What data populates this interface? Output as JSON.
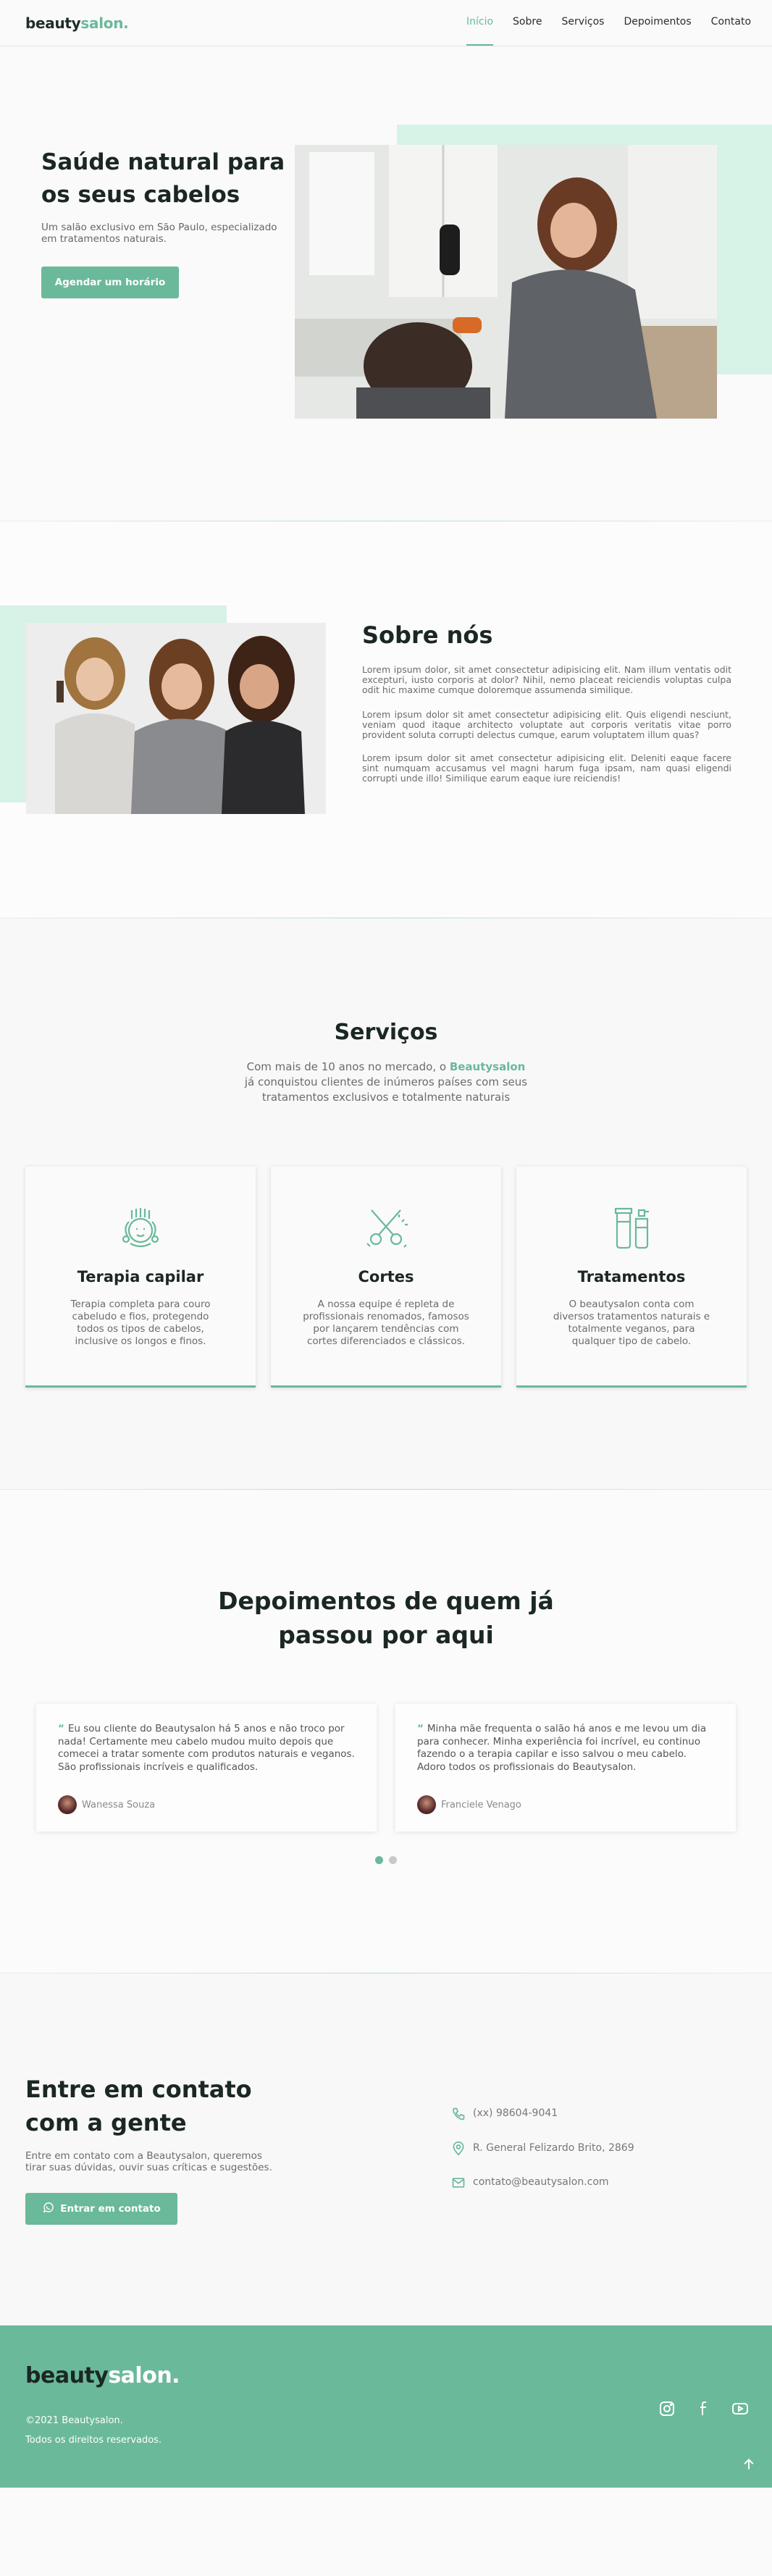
{
  "brand": {
    "name_dark": "beauty",
    "name_accent": "salon."
  },
  "nav": {
    "items": [
      {
        "label": "Início",
        "active": true
      },
      {
        "label": "Sobre",
        "active": false
      },
      {
        "label": "Serviços",
        "active": false
      },
      {
        "label": "Depoimentos",
        "active": false
      },
      {
        "label": "Contato",
        "active": false
      }
    ]
  },
  "home": {
    "title": "Saúde natural para os seus cabelos",
    "description": "Um salão exclusivo em São Paulo, especializado em tratamentos naturais.",
    "cta_label": "Agendar um horário"
  },
  "about": {
    "title": "Sobre nós",
    "paragraphs": [
      "Lorem ipsum dolor, sit amet consectetur adipisicing elit. Nam illum ventatis odit excepturi, iusto corporis at dolor? Nihil, nemo placeat reiciendis voluptas culpa odit hic maxime cumque doloremque assumenda similique.",
      "Lorem ipsum dolor sit amet consectetur adipisicing elit. Quis eligendi nesciunt, veniam quod itaque architecto voluptate aut corporis veritatis vitae porro provident soluta corrupti delectus cumque, earum voluptatem illum quas?",
      "Lorem ipsum dolor sit amet consectetur adipisicing elit. Deleniti eaque facere sint numquam accusamus vel magni harum fuga ipsam, nam quasi eligendi corrupti unde illo! Similique earum eaque iure reiciendis!"
    ]
  },
  "services": {
    "title": "Serviços",
    "subtitle_pre": "Com mais de 10 anos no mercado, o ",
    "subtitle_brand": "Beautysalon",
    "subtitle_post": " já conquistou clientes de inúmeros países com seus tratamentos exclusivos e totalmente naturais",
    "cards": [
      {
        "icon": "hair-therapy-icon",
        "title": "Terapia capilar",
        "description": "Terapia completa para couro cabeludo e fios, protegendo todos os tipos de cabelos, inclusive os longos e finos."
      },
      {
        "icon": "scissors-icon",
        "title": "Cortes",
        "description": "A nossa equipe é repleta de profissionais renomados, famosos por lançarem tendências com cortes diferenciados e clássicos."
      },
      {
        "icon": "products-icon",
        "title": "Tratamentos",
        "description": "O beautysalon conta com diversos tratamentos naturais e totalmente veganos, para qualquer tipo de cabelo."
      }
    ]
  },
  "testimonials": {
    "title_line1": "Depoimentos de quem já",
    "title_line2": "passou por aqui",
    "items": [
      {
        "quote_mark": "“",
        "text": "Eu sou cliente do Beautysalon há 5 anos e não troco por nada! Certamente meu cabelo mudou muito depois que comecei a tratar somente com produtos naturais e veganos. São profissionais incríveis e qualificados.",
        "author": "Wanessa Souza"
      },
      {
        "quote_mark": "“",
        "text": "Minha mãe frequenta o salão há anos e me levou um dia para conhecer. Minha experiência foi incrível, eu continuo fazendo o a terapia capilar e isso salvou o meu cabelo. Adoro todos os profissionais do Beautysalon.",
        "author": "Franciele Venago"
      }
    ],
    "pagination": {
      "pages": 2,
      "current": 1
    }
  },
  "contact": {
    "title": "Entre em contato com a gente",
    "description": "Entre em contato com a Beautysalon, queremos tirar suas dúvidas, ouvir suas críticas e sugestões.",
    "cta_label": "Entrar em contato",
    "phone": "(xx) 98604-9041",
    "address": "R. General Felizardo Brito, 2869",
    "email": "contato@beautysalon.com"
  },
  "footer": {
    "copyright": "©2021 Beautysalon.",
    "rights": "Todos os direitos reservados.",
    "social": [
      "instagram-icon",
      "facebook-icon",
      "youtube-icon"
    ]
  },
  "colors": {
    "accent": "#6ab99a",
    "accent_light": "#d7f2e7",
    "dark": "#1b2723",
    "footer": "#6ab99a"
  }
}
